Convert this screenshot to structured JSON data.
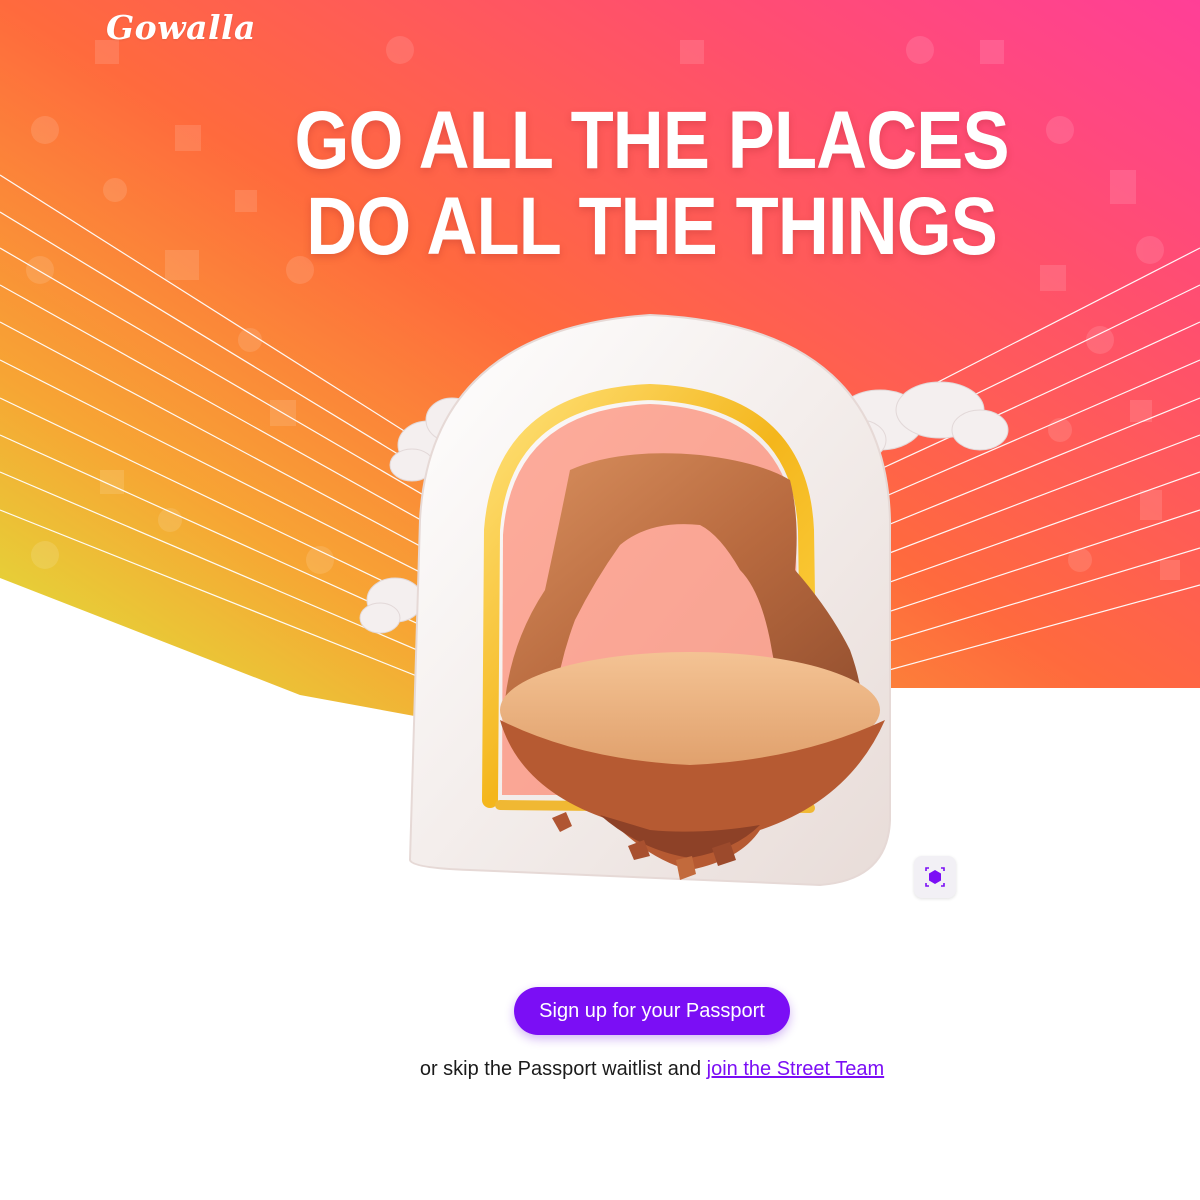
{
  "brand": {
    "logo_text": "Gowalla"
  },
  "hero": {
    "headline_line1": "GO ALL THE PLACES",
    "headline_line2": "DO ALL THE THINGS",
    "gradient_colors": [
      "#d9f03a",
      "#f7a534",
      "#ff6a3d",
      "#ff4f6e",
      "#ff3f97"
    ]
  },
  "cta": {
    "signup_label": "Sign up for your Passport"
  },
  "secondary": {
    "prefix_text": "or skip the Passport waitlist and",
    "link_text": "join the Street Team"
  },
  "icons": {
    "ar_view": "ar-cube-icon",
    "illustration": "delicate-arch-portal-illustration"
  }
}
